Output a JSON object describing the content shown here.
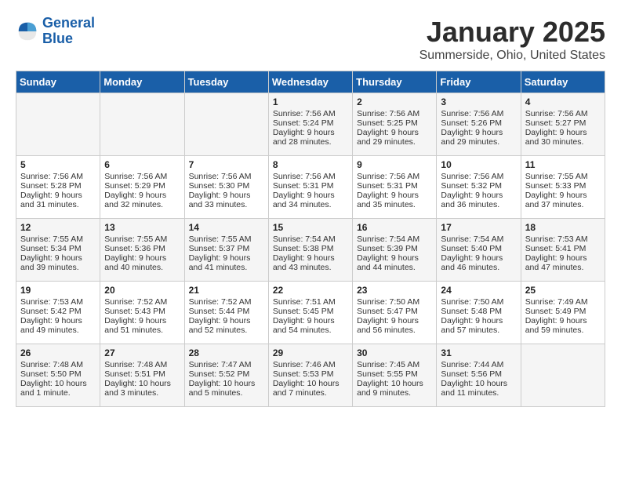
{
  "header": {
    "logo_line1": "General",
    "logo_line2": "Blue",
    "month": "January 2025",
    "location": "Summerside, Ohio, United States"
  },
  "days_of_week": [
    "Sunday",
    "Monday",
    "Tuesday",
    "Wednesday",
    "Thursday",
    "Friday",
    "Saturday"
  ],
  "weeks": [
    [
      {
        "day": "",
        "sunrise": "",
        "sunset": "",
        "daylight": ""
      },
      {
        "day": "",
        "sunrise": "",
        "sunset": "",
        "daylight": ""
      },
      {
        "day": "",
        "sunrise": "",
        "sunset": "",
        "daylight": ""
      },
      {
        "day": "1",
        "sunrise": "Sunrise: 7:56 AM",
        "sunset": "Sunset: 5:24 PM",
        "daylight": "Daylight: 9 hours and 28 minutes."
      },
      {
        "day": "2",
        "sunrise": "Sunrise: 7:56 AM",
        "sunset": "Sunset: 5:25 PM",
        "daylight": "Daylight: 9 hours and 29 minutes."
      },
      {
        "day": "3",
        "sunrise": "Sunrise: 7:56 AM",
        "sunset": "Sunset: 5:26 PM",
        "daylight": "Daylight: 9 hours and 29 minutes."
      },
      {
        "day": "4",
        "sunrise": "Sunrise: 7:56 AM",
        "sunset": "Sunset: 5:27 PM",
        "daylight": "Daylight: 9 hours and 30 minutes."
      }
    ],
    [
      {
        "day": "5",
        "sunrise": "Sunrise: 7:56 AM",
        "sunset": "Sunset: 5:28 PM",
        "daylight": "Daylight: 9 hours and 31 minutes."
      },
      {
        "day": "6",
        "sunrise": "Sunrise: 7:56 AM",
        "sunset": "Sunset: 5:29 PM",
        "daylight": "Daylight: 9 hours and 32 minutes."
      },
      {
        "day": "7",
        "sunrise": "Sunrise: 7:56 AM",
        "sunset": "Sunset: 5:30 PM",
        "daylight": "Daylight: 9 hours and 33 minutes."
      },
      {
        "day": "8",
        "sunrise": "Sunrise: 7:56 AM",
        "sunset": "Sunset: 5:31 PM",
        "daylight": "Daylight: 9 hours and 34 minutes."
      },
      {
        "day": "9",
        "sunrise": "Sunrise: 7:56 AM",
        "sunset": "Sunset: 5:31 PM",
        "daylight": "Daylight: 9 hours and 35 minutes."
      },
      {
        "day": "10",
        "sunrise": "Sunrise: 7:56 AM",
        "sunset": "Sunset: 5:32 PM",
        "daylight": "Daylight: 9 hours and 36 minutes."
      },
      {
        "day": "11",
        "sunrise": "Sunrise: 7:55 AM",
        "sunset": "Sunset: 5:33 PM",
        "daylight": "Daylight: 9 hours and 37 minutes."
      }
    ],
    [
      {
        "day": "12",
        "sunrise": "Sunrise: 7:55 AM",
        "sunset": "Sunset: 5:34 PM",
        "daylight": "Daylight: 9 hours and 39 minutes."
      },
      {
        "day": "13",
        "sunrise": "Sunrise: 7:55 AM",
        "sunset": "Sunset: 5:36 PM",
        "daylight": "Daylight: 9 hours and 40 minutes."
      },
      {
        "day": "14",
        "sunrise": "Sunrise: 7:55 AM",
        "sunset": "Sunset: 5:37 PM",
        "daylight": "Daylight: 9 hours and 41 minutes."
      },
      {
        "day": "15",
        "sunrise": "Sunrise: 7:54 AM",
        "sunset": "Sunset: 5:38 PM",
        "daylight": "Daylight: 9 hours and 43 minutes."
      },
      {
        "day": "16",
        "sunrise": "Sunrise: 7:54 AM",
        "sunset": "Sunset: 5:39 PM",
        "daylight": "Daylight: 9 hours and 44 minutes."
      },
      {
        "day": "17",
        "sunrise": "Sunrise: 7:54 AM",
        "sunset": "Sunset: 5:40 PM",
        "daylight": "Daylight: 9 hours and 46 minutes."
      },
      {
        "day": "18",
        "sunrise": "Sunrise: 7:53 AM",
        "sunset": "Sunset: 5:41 PM",
        "daylight": "Daylight: 9 hours and 47 minutes."
      }
    ],
    [
      {
        "day": "19",
        "sunrise": "Sunrise: 7:53 AM",
        "sunset": "Sunset: 5:42 PM",
        "daylight": "Daylight: 9 hours and 49 minutes."
      },
      {
        "day": "20",
        "sunrise": "Sunrise: 7:52 AM",
        "sunset": "Sunset: 5:43 PM",
        "daylight": "Daylight: 9 hours and 51 minutes."
      },
      {
        "day": "21",
        "sunrise": "Sunrise: 7:52 AM",
        "sunset": "Sunset: 5:44 PM",
        "daylight": "Daylight: 9 hours and 52 minutes."
      },
      {
        "day": "22",
        "sunrise": "Sunrise: 7:51 AM",
        "sunset": "Sunset: 5:45 PM",
        "daylight": "Daylight: 9 hours and 54 minutes."
      },
      {
        "day": "23",
        "sunrise": "Sunrise: 7:50 AM",
        "sunset": "Sunset: 5:47 PM",
        "daylight": "Daylight: 9 hours and 56 minutes."
      },
      {
        "day": "24",
        "sunrise": "Sunrise: 7:50 AM",
        "sunset": "Sunset: 5:48 PM",
        "daylight": "Daylight: 9 hours and 57 minutes."
      },
      {
        "day": "25",
        "sunrise": "Sunrise: 7:49 AM",
        "sunset": "Sunset: 5:49 PM",
        "daylight": "Daylight: 9 hours and 59 minutes."
      }
    ],
    [
      {
        "day": "26",
        "sunrise": "Sunrise: 7:48 AM",
        "sunset": "Sunset: 5:50 PM",
        "daylight": "Daylight: 10 hours and 1 minute."
      },
      {
        "day": "27",
        "sunrise": "Sunrise: 7:48 AM",
        "sunset": "Sunset: 5:51 PM",
        "daylight": "Daylight: 10 hours and 3 minutes."
      },
      {
        "day": "28",
        "sunrise": "Sunrise: 7:47 AM",
        "sunset": "Sunset: 5:52 PM",
        "daylight": "Daylight: 10 hours and 5 minutes."
      },
      {
        "day": "29",
        "sunrise": "Sunrise: 7:46 AM",
        "sunset": "Sunset: 5:53 PM",
        "daylight": "Daylight: 10 hours and 7 minutes."
      },
      {
        "day": "30",
        "sunrise": "Sunrise: 7:45 AM",
        "sunset": "Sunset: 5:55 PM",
        "daylight": "Daylight: 10 hours and 9 minutes."
      },
      {
        "day": "31",
        "sunrise": "Sunrise: 7:44 AM",
        "sunset": "Sunset: 5:56 PM",
        "daylight": "Daylight: 10 hours and 11 minutes."
      },
      {
        "day": "",
        "sunrise": "",
        "sunset": "",
        "daylight": ""
      }
    ]
  ]
}
